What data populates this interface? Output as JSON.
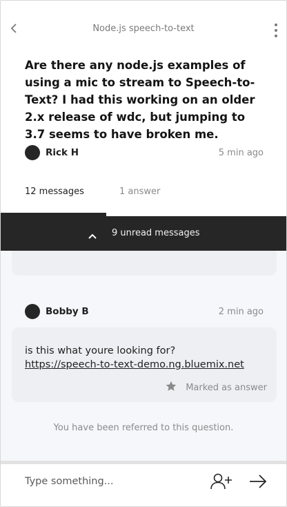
{
  "header": {
    "title": "Node.js speech-to-text",
    "back_icon": "chevron-left-icon",
    "menu_icon": "kebab-menu-icon"
  },
  "question": {
    "text": "Are there any node.js examples of using a mic to stream to Speech-to-Text? I had this working on an older 2.x release of wdc, but jumping to 3.7 seems to have broken me.",
    "author": "Rick H",
    "time": "5 min ago"
  },
  "tabs": [
    {
      "label": "12 messages",
      "active": true
    },
    {
      "label": "1 answer",
      "active": false
    }
  ],
  "unread": {
    "label": "9 unread messages",
    "icon": "chevron-up-icon"
  },
  "reply": {
    "author": "Bobby B",
    "time": "2 min ago",
    "text": "is this what youre looking for?",
    "link": "https://speech-to-text-demo.ng.bluemix.net",
    "answer_label": "Marked as answer",
    "answer_icon": "star-icon"
  },
  "notice": "You have been referred to this question.",
  "composer": {
    "placeholder": "Type something...",
    "add_icon": "add-person-icon",
    "send_icon": "send-arrow-icon"
  },
  "colors": {
    "dark": "#262626",
    "muted": "#8a8a8a",
    "thread_bg": "#f6f7fa",
    "card_bg": "#eeeff2"
  }
}
